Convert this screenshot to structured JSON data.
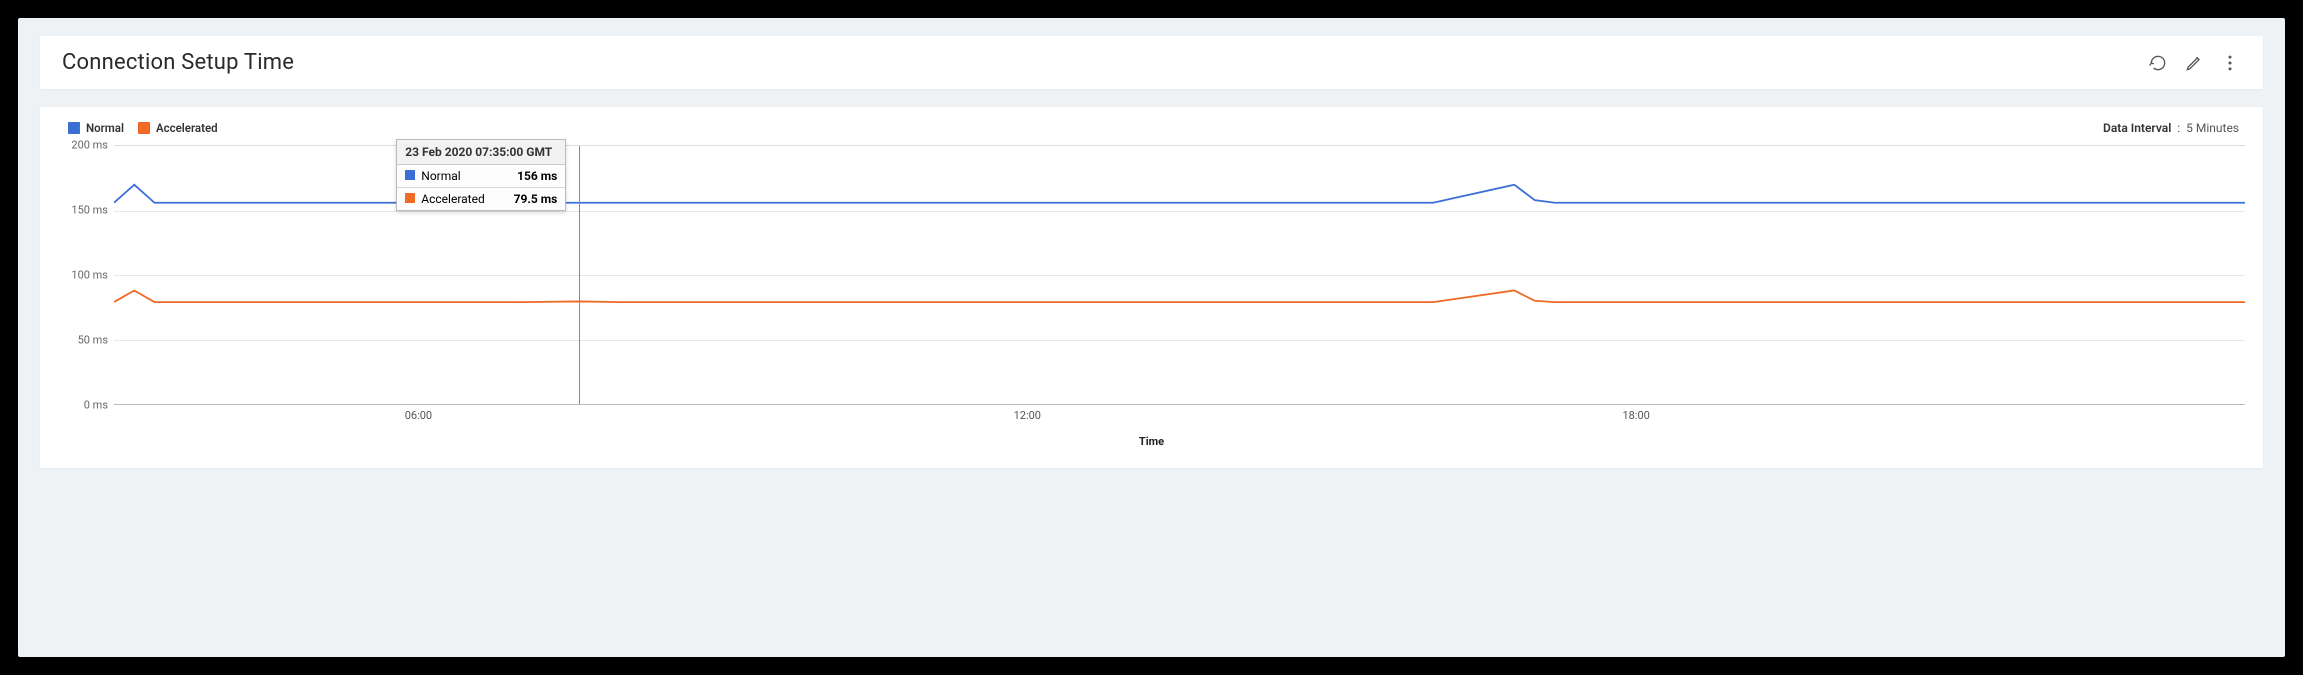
{
  "header": {
    "title": "Connection Setup Time"
  },
  "legend": {
    "items": [
      {
        "name": "Normal",
        "color": "#3b6fd6"
      },
      {
        "name": "Accelerated",
        "color": "#ef6a24"
      }
    ]
  },
  "data_interval": {
    "label": "Data Interval",
    "value": "5 Minutes"
  },
  "axes": {
    "y": {
      "min": 0,
      "max": 200,
      "unit": "ms",
      "ticks": [
        0,
        50,
        100,
        150,
        200
      ]
    },
    "x": {
      "label": "Time",
      "ticks": [
        "06:00",
        "12:00",
        "18:00"
      ],
      "range_hours": [
        3,
        24
      ]
    }
  },
  "tooltip": {
    "timestamp": "23 Feb 2020 07:35:00 GMT",
    "rows": [
      {
        "series": "Normal",
        "color": "#3b6fd6",
        "value": "156 ms"
      },
      {
        "series": "Accelerated",
        "color": "#ef6a24",
        "value": "79.5 ms"
      }
    ],
    "at_hour": 7.583
  },
  "chart_data": {
    "type": "line",
    "title": "Connection Setup Time",
    "xlabel": "Time",
    "ylabel": "ms",
    "ylim": [
      0,
      200
    ],
    "x_hours": [
      3,
      3.2,
      3.4,
      4,
      5,
      6,
      7,
      7.583,
      8,
      9,
      10,
      11,
      12,
      13,
      14,
      15,
      16,
      16.8,
      17,
      17.2,
      18,
      19,
      20,
      21,
      22,
      23,
      24
    ],
    "series": [
      {
        "name": "Normal",
        "color": "#3b6fd6",
        "values": [
          156,
          170,
          156,
          156,
          156,
          156,
          156,
          156,
          156,
          156,
          156,
          156,
          156,
          156,
          156,
          156,
          156,
          170,
          158,
          156,
          156,
          156,
          156,
          156,
          156,
          156,
          156
        ]
      },
      {
        "name": "Accelerated",
        "color": "#ef6a24",
        "values": [
          79,
          88,
          79,
          79,
          79,
          79,
          79,
          79.5,
          79,
          79,
          79,
          79,
          79,
          79,
          79,
          79,
          79,
          88,
          80,
          79,
          79,
          79,
          79,
          79,
          79,
          79,
          79
        ]
      }
    ]
  }
}
